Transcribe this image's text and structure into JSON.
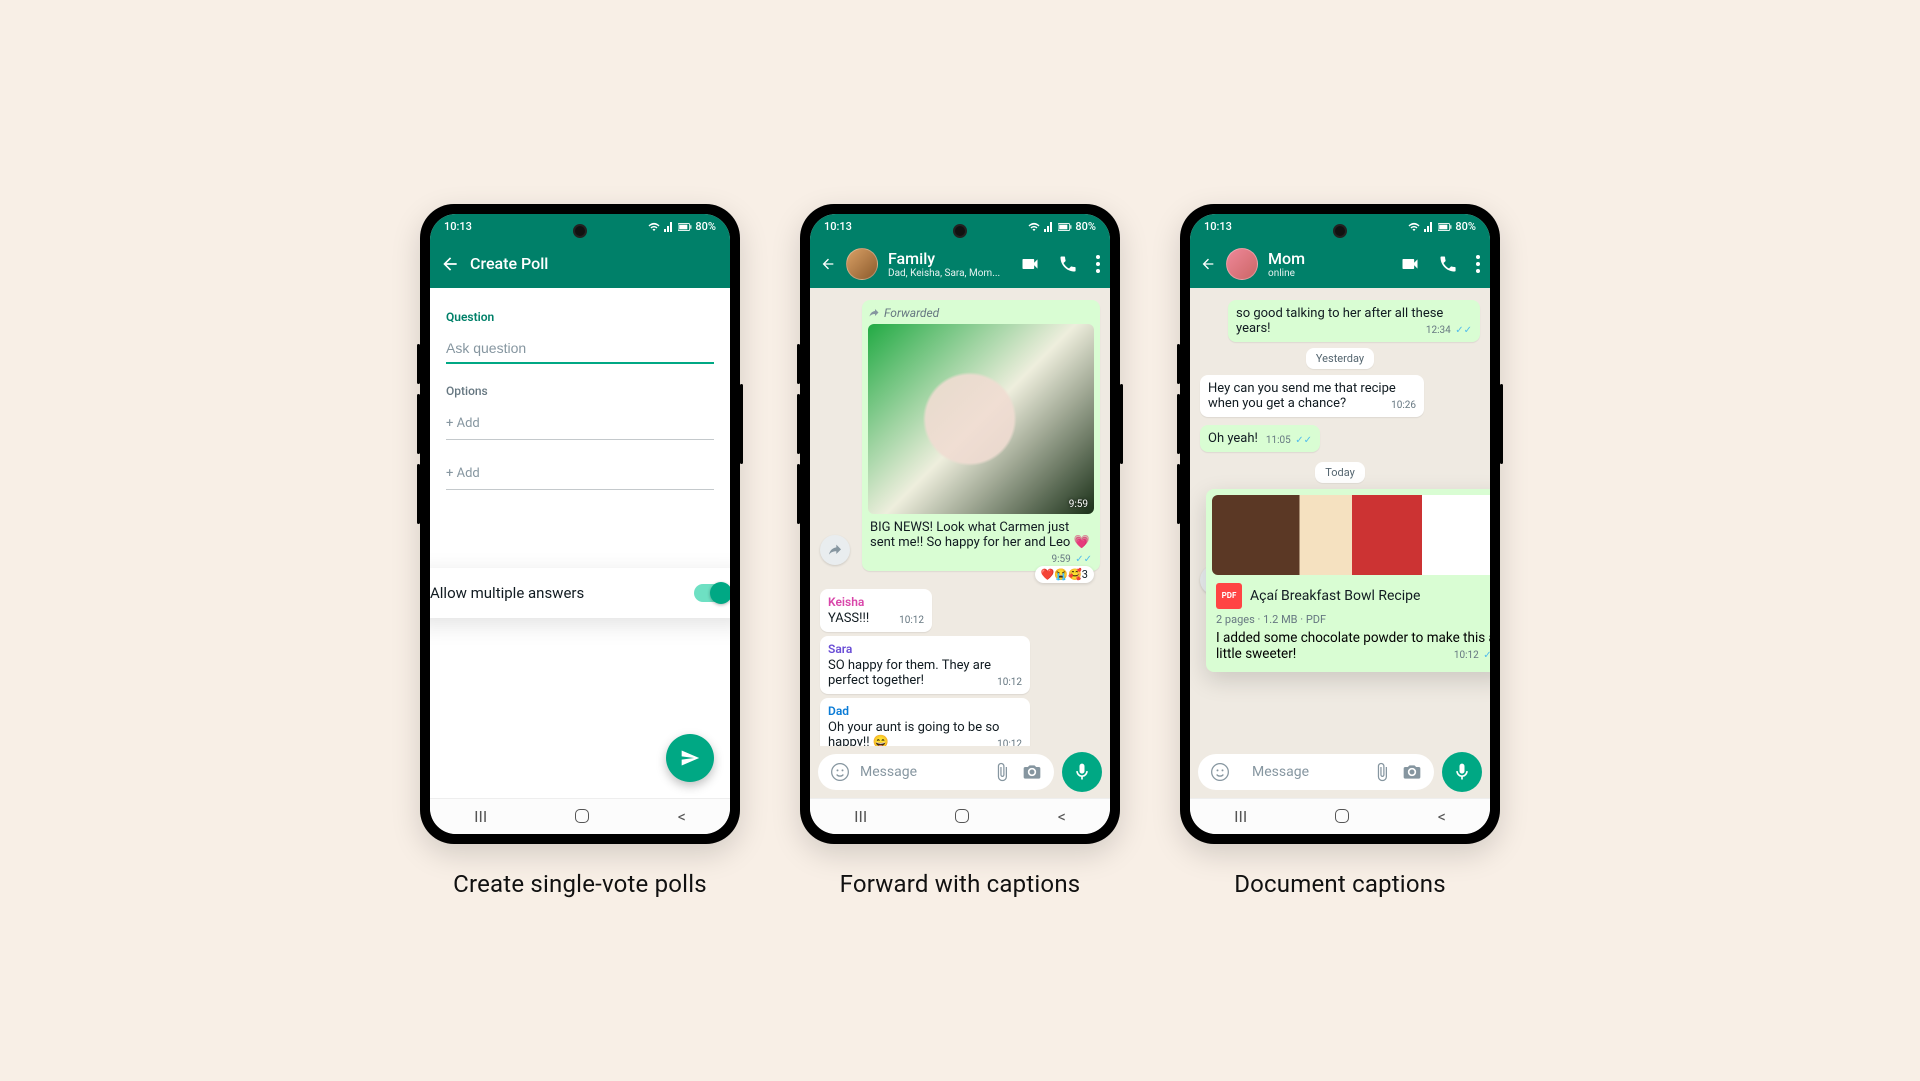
{
  "status": {
    "time": "10:13",
    "battery": "80%"
  },
  "captions": {
    "poll": "Create single-vote polls",
    "forward": "Forward with captions",
    "document": "Document captions"
  },
  "poll": {
    "header": "Create Poll",
    "questionLabel": "Question",
    "questionPlaceholder": "Ask question",
    "optionsLabel": "Options",
    "addPlaceholder": "+ Add",
    "toggleLabel": "Allow multiple answers"
  },
  "forward": {
    "chatName": "Family",
    "members": "Dad, Keisha, Sara, Mom...",
    "forwardedTag": "Forwarded",
    "imageTime": "9:59",
    "caption": "BIG NEWS! Look what Carmen just sent me!! So happy for her and Leo 💗",
    "captionTime": "9:59",
    "reactions": "❤️😭🥰3",
    "msgs": [
      {
        "sender": "Keisha",
        "color": "#d946aa",
        "text": "YASS!!!",
        "time": "10:12"
      },
      {
        "sender": "Sara",
        "color": "#6b4fd6",
        "text": "SO happy for them. They are perfect together!",
        "time": "10:12"
      },
      {
        "sender": "Dad",
        "color": "#0a7bd6",
        "text": "Oh your aunt is going to be so happy!! 😄",
        "time": "10:12"
      }
    ],
    "inputPlaceholder": "Message"
  },
  "doc": {
    "chatName": "Mom",
    "status": "online",
    "topMsg": "so good talking to her after all these years!",
    "topTime": "12:34",
    "yesterday": "Yesterday",
    "inMsg": "Hey can you send me that recipe when you get a chance?",
    "inTime": "10:26",
    "outMsg": "Oh yeah!",
    "outTime": "11:05",
    "today": "Today",
    "docTitle": "Açaí Breakfast Bowl Recipe",
    "docMeta": "2 pages · 1.2 MB · PDF",
    "docCaption": "I added some chocolate powder to make this a little sweeter!",
    "docTime": "10:12",
    "inputPlaceholder": "Message"
  }
}
